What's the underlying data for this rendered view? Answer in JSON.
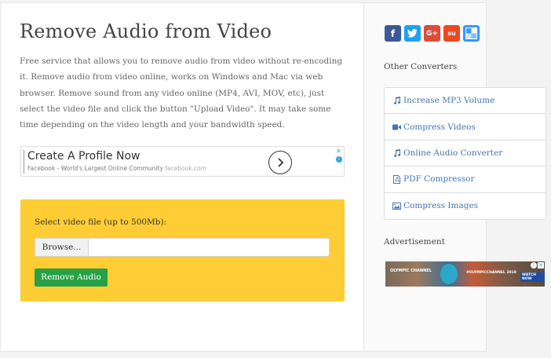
{
  "page": {
    "title": "Remove Audio from Video",
    "description": "Free service that allows you to remove audio from video without re-encoding it. Remove audio from video online, works on Windows and Mac via web browser. Remove sound from any video online (MP4, AVI, MOV, etc), just select the video file and click the button \"Upload Video\". It may take some time depending on the video length and your bandwidth speed."
  },
  "ad": {
    "headline": "Create A Profile Now",
    "sub": "Facebook - World's Largest Online Community",
    "domain": "facebook.com",
    "close": "✕",
    "info": "i"
  },
  "upload": {
    "label": "Select video file (up to 500Mb):",
    "browse_label": "Browse...",
    "file_value": "",
    "submit_label": "Remove Audio"
  },
  "social": [
    {
      "name": "facebook",
      "glyph": "f",
      "color": "#3b5998"
    },
    {
      "name": "twitter",
      "glyph": "t",
      "color": "#1da1f2"
    },
    {
      "name": "google-plus",
      "glyph": "G+",
      "color": "#dd4b39"
    },
    {
      "name": "stumbleupon",
      "glyph": "su",
      "color": "#eb4924"
    },
    {
      "name": "delicious",
      "glyph": "",
      "color": "#3399ff"
    }
  ],
  "sidebar": {
    "other_heading": "Other Converters",
    "converters": [
      {
        "label": "Increase MP3 Volume",
        "icon": "music-icon"
      },
      {
        "label": "Compress Videos",
        "icon": "video-icon"
      },
      {
        "label": "Online Audio Converter",
        "icon": "music-icon"
      },
      {
        "label": "PDF Compressor",
        "icon": "file-pdf-icon"
      },
      {
        "label": "Compress Images",
        "icon": "image-icon"
      }
    ],
    "advert_heading": "Advertisement"
  },
  "banner": {
    "brand": "OLYMPIC CHANNEL",
    "middle": "#OLYMPICCHANNEL 2018",
    "cta": "WATCH NOW"
  }
}
